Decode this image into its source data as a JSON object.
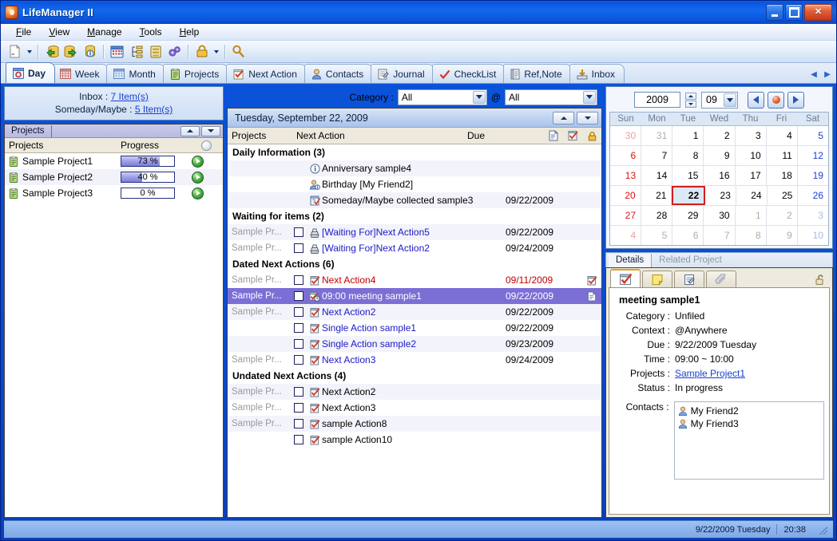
{
  "window": {
    "title": "LifeManager II",
    "app_icon": "app-icon",
    "minimize": "minimize-button",
    "maximize": "maximize-button",
    "close": "close-button"
  },
  "menu": [
    {
      "label": "File",
      "accel": "F"
    },
    {
      "label": "View",
      "accel": "V"
    },
    {
      "label": "Manage",
      "accel": "M"
    },
    {
      "label": "Tools",
      "accel": "T"
    },
    {
      "label": "Help",
      "accel": "H"
    }
  ],
  "toolbar": {
    "buttons": [
      {
        "name": "new-item-icon"
      },
      {
        "name": "new-item-dropdown-arrow"
      },
      {
        "name": "import-database-icon"
      },
      {
        "name": "export-database-icon"
      },
      {
        "name": "database-info-icon"
      },
      {
        "name": "calendar-icon"
      },
      {
        "name": "tree-outline-icon"
      },
      {
        "name": "list-icon"
      },
      {
        "name": "settings-gears-icon"
      },
      {
        "name": "lock-icon"
      },
      {
        "name": "lock-dropdown-arrow"
      },
      {
        "name": "search-icon"
      }
    ]
  },
  "view_tabs": {
    "items": [
      {
        "label": "Day",
        "icon": "day-view-icon",
        "active": true
      },
      {
        "label": "Week",
        "icon": "week-view-icon",
        "active": false
      },
      {
        "label": "Month",
        "icon": "month-view-icon",
        "active": false
      },
      {
        "label": "Projects",
        "icon": "projects-icon",
        "active": false
      },
      {
        "label": "Next Action",
        "icon": "next-action-icon",
        "active": false
      },
      {
        "label": "Contacts",
        "icon": "contacts-icon",
        "active": false
      },
      {
        "label": "Journal",
        "icon": "journal-icon",
        "active": false
      },
      {
        "label": "CheckList",
        "icon": "checklist-icon",
        "active": false
      },
      {
        "label": "Ref,Note",
        "icon": "reference-note-icon",
        "active": false
      },
      {
        "label": "Inbox",
        "icon": "inbox-icon",
        "active": false
      }
    ],
    "scroll_left": "tab-scroll-left-icon",
    "scroll_right": "tab-scroll-right-icon"
  },
  "sidebar": {
    "inbox": {
      "label": "Inbox :",
      "value": "7 Item(s)"
    },
    "someday": {
      "label": "Someday/Maybe :",
      "value": "5 Item(s)"
    },
    "projects_panel": {
      "tab_label": "Projects",
      "columns": [
        "Projects",
        "Progress"
      ],
      "sort_icon": "sort-circle-icon",
      "rows": [
        {
          "name": "Sample Project1",
          "progress": 73,
          "progress_label": "73 %"
        },
        {
          "name": "Sample Project2",
          "progress": 40,
          "progress_label": "40 %"
        },
        {
          "name": "Sample Project3",
          "progress": 0,
          "progress_label": "0 %"
        }
      ]
    }
  },
  "filters": {
    "category_label": "Category :",
    "category_value": "All",
    "at_label": "@",
    "context_value": "All"
  },
  "list": {
    "date_header": "Tuesday, September 22, 2009",
    "columns": {
      "projects": "Projects",
      "next_action": "Next Action",
      "due": "Due",
      "icon_note": "note-column-icon",
      "icon_checklist": "checklist-column-icon",
      "icon_lock": "lock-column-icon"
    },
    "groups": [
      {
        "title": "Daily Information (3)",
        "items": [
          {
            "project": "",
            "checkbox": false,
            "has_checkbox": false,
            "icon": "info-icon",
            "title": "Anniversary sample4",
            "due": "",
            "style": "link",
            "trailing_icon": ""
          },
          {
            "project": "",
            "checkbox": false,
            "has_checkbox": false,
            "icon": "birthday-contact-icon",
            "title": "Birthday [My Friend2]",
            "due": "",
            "style": "black",
            "trailing_icon": ""
          },
          {
            "project": "",
            "checkbox": false,
            "has_checkbox": false,
            "icon": "someday-icon",
            "title": "Someday/Maybe collected sample3",
            "due": "09/22/2009",
            "style": "black",
            "trailing_icon": ""
          }
        ]
      },
      {
        "title": "Waiting for items (2)",
        "items": [
          {
            "project": "Sample Pr...",
            "checkbox": false,
            "has_checkbox": true,
            "icon": "waiting-for-icon",
            "title": "[Waiting For]Next Action5",
            "due": "09/22/2009",
            "style": "link",
            "trailing_icon": ""
          },
          {
            "project": "Sample Pr...",
            "checkbox": false,
            "has_checkbox": true,
            "icon": "waiting-for-icon",
            "title": "[Waiting For]Next Action2",
            "due": "09/24/2009",
            "style": "link",
            "trailing_icon": ""
          }
        ]
      },
      {
        "title": "Dated Next Actions (6)",
        "items": [
          {
            "project": "Sample Pr...",
            "checkbox": false,
            "has_checkbox": true,
            "icon": "next-action-item-icon",
            "title": "Next Action4",
            "due": "09/11/2009",
            "style": "overdue",
            "trailing_icon": "checklist-column-icon"
          },
          {
            "project": "Sample Pr...",
            "checkbox": false,
            "has_checkbox": true,
            "icon": "appointment-icon",
            "title": "09:00 meeting sample1",
            "due": "09/22/2009",
            "style": "selected",
            "trailing_icon": "note-column-icon"
          },
          {
            "project": "Sample Pr...",
            "checkbox": false,
            "has_checkbox": true,
            "icon": "next-action-item-icon",
            "title": "Next Action2",
            "due": "09/22/2009",
            "style": "link",
            "trailing_icon": ""
          },
          {
            "project": "",
            "checkbox": false,
            "has_checkbox": true,
            "icon": "next-action-item-icon",
            "title": "Single Action sample1",
            "due": "09/22/2009",
            "style": "link",
            "trailing_icon": ""
          },
          {
            "project": "",
            "checkbox": false,
            "has_checkbox": true,
            "icon": "next-action-item-icon",
            "title": "Single Action sample2",
            "due": "09/23/2009",
            "style": "link",
            "trailing_icon": ""
          },
          {
            "project": "Sample Pr...",
            "checkbox": false,
            "has_checkbox": true,
            "icon": "next-action-item-icon",
            "title": "Next Action3",
            "due": "09/24/2009",
            "style": "link",
            "trailing_icon": ""
          }
        ]
      },
      {
        "title": "Undated Next Actions (4)",
        "items": [
          {
            "project": "Sample Pr...",
            "checkbox": false,
            "has_checkbox": true,
            "icon": "next-action-item-icon",
            "title": "Next Action2",
            "due": "",
            "style": "black",
            "trailing_icon": ""
          },
          {
            "project": "Sample Pr...",
            "checkbox": false,
            "has_checkbox": true,
            "icon": "next-action-item-icon",
            "title": "Next Action3",
            "due": "",
            "style": "black",
            "trailing_icon": ""
          },
          {
            "project": "Sample Pr...",
            "checkbox": false,
            "has_checkbox": true,
            "icon": "next-action-item-icon",
            "title": "sample Action8",
            "due": "",
            "style": "black",
            "trailing_icon": ""
          },
          {
            "project": "",
            "checkbox": false,
            "has_checkbox": true,
            "icon": "next-action-item-icon",
            "title": "sample Action10",
            "due": "",
            "style": "black",
            "trailing_icon": ""
          }
        ]
      }
    ]
  },
  "calendar": {
    "year": "2009",
    "month": "09",
    "prev_icon": "calendar-prev-icon",
    "today_icon": "calendar-today-icon",
    "next_icon": "calendar-next-icon",
    "weekdays": [
      "Sun",
      "Mon",
      "Tue",
      "Wed",
      "Thu",
      "Fri",
      "Sat"
    ],
    "weeks": [
      [
        {
          "d": "30",
          "o": true
        },
        {
          "d": "31",
          "o": true
        },
        {
          "d": "1"
        },
        {
          "d": "2"
        },
        {
          "d": "3"
        },
        {
          "d": "4"
        },
        {
          "d": "5"
        }
      ],
      [
        {
          "d": "6"
        },
        {
          "d": "7"
        },
        {
          "d": "8"
        },
        {
          "d": "9"
        },
        {
          "d": "10"
        },
        {
          "d": "11"
        },
        {
          "d": "12"
        }
      ],
      [
        {
          "d": "13"
        },
        {
          "d": "14"
        },
        {
          "d": "15"
        },
        {
          "d": "16"
        },
        {
          "d": "17"
        },
        {
          "d": "18"
        },
        {
          "d": "19"
        }
      ],
      [
        {
          "d": "20"
        },
        {
          "d": "21"
        },
        {
          "d": "22",
          "today": true
        },
        {
          "d": "23"
        },
        {
          "d": "24"
        },
        {
          "d": "25"
        },
        {
          "d": "26"
        }
      ],
      [
        {
          "d": "27"
        },
        {
          "d": "28"
        },
        {
          "d": "29"
        },
        {
          "d": "30"
        },
        {
          "d": "1",
          "o": true
        },
        {
          "d": "2",
          "o": true
        },
        {
          "d": "3",
          "o": true
        }
      ],
      [
        {
          "d": "4",
          "o": true
        },
        {
          "d": "5",
          "o": true
        },
        {
          "d": "6",
          "o": true
        },
        {
          "d": "7",
          "o": true
        },
        {
          "d": "8",
          "o": true
        },
        {
          "d": "9",
          "o": true
        },
        {
          "d": "10",
          "o": true
        }
      ]
    ]
  },
  "details": {
    "tabs": [
      {
        "label": "Details",
        "active": true
      },
      {
        "label": "Related Project",
        "active": false
      }
    ],
    "inner_tabs": [
      {
        "name": "detail-checklist-tab",
        "icon": "checklist-tab-icon",
        "active": true
      },
      {
        "name": "detail-note-tab",
        "icon": "yellow-note-icon",
        "active": false
      },
      {
        "name": "detail-form-tab",
        "icon": "edit-form-icon",
        "active": false
      },
      {
        "name": "detail-attach-tab",
        "icon": "paperclip-icon",
        "active": false
      }
    ],
    "lock_icon": "unlock-icon",
    "title": "meeting sample1",
    "fields": [
      {
        "label": "Category :",
        "value": "Unfiled",
        "link": false
      },
      {
        "label": "Context :",
        "value": "@Anywhere",
        "link": false
      },
      {
        "label": "Due :",
        "value": "9/22/2009 Tuesday",
        "link": false
      },
      {
        "label": "Time :",
        "value": "09:00 ~ 10:00",
        "link": false
      },
      {
        "label": "Projects :",
        "value": "Sample Project1",
        "link": true
      },
      {
        "label": "Status :",
        "value": "In progress",
        "link": false
      }
    ],
    "contacts_label": "Contacts :",
    "contacts": [
      "My Friend2",
      "My Friend3"
    ]
  },
  "statusbar": {
    "date": "9/22/2009 Tuesday",
    "time": "20:38",
    "grip": "resize-grip"
  },
  "colors": {
    "title_blue": "#0B55DE",
    "selection": "#7B6FD6",
    "link": "#1A1AC8",
    "overdue": "#C00000",
    "header_beige": "#EDE9DC",
    "accent_orange": "#E8A020"
  }
}
